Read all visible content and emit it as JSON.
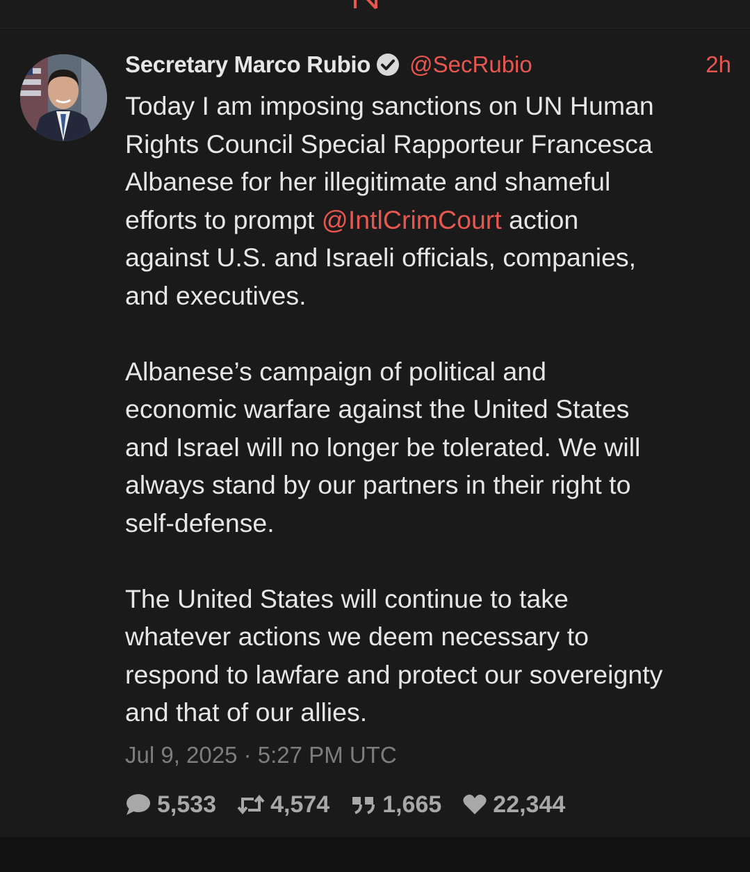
{
  "colors": {
    "accent": "#e8574f",
    "text": "#e6e6e6",
    "muted": "#7d7d7d",
    "card_bg": "#1a1a1a",
    "page_bg": "#111111"
  },
  "post": {
    "author_name": "Secretary Marco Rubio",
    "verified_icon": "verified-check-icon",
    "handle": "@SecRubio",
    "relative_time": "2h",
    "paragraph1": {
      "line1": "Today I am imposing sanctions on UN Human",
      "line2": "Rights Council Special Rapporteur Francesca",
      "line3": "Albanese for her illegitimate and shameful",
      "line4_before": "efforts to prompt ",
      "mention": "@IntlCrimCourt",
      "line4_after": " action",
      "line5": "against U.S. and Israeli officials, companies,",
      "line6": "and executives."
    },
    "paragraph2": {
      "line1": "Albanese’s campaign of political and",
      "line2": "economic warfare against the United States",
      "line3": "and Israel will no longer be tolerated. We will",
      "line4": "always stand by our partners in their right to",
      "line5": "self-defense."
    },
    "paragraph3": {
      "line1": "The United States will continue to take",
      "line2": "whatever actions we deem necessary to",
      "line3": "respond to lawfare and protect our sovereignty",
      "line4": "and that of our allies."
    },
    "timestamp": "Jul 9, 2025 · 5:27 PM UTC",
    "stats": {
      "replies": "5,533",
      "reposts": "4,574",
      "quotes": "1,665",
      "likes": "22,344"
    }
  }
}
